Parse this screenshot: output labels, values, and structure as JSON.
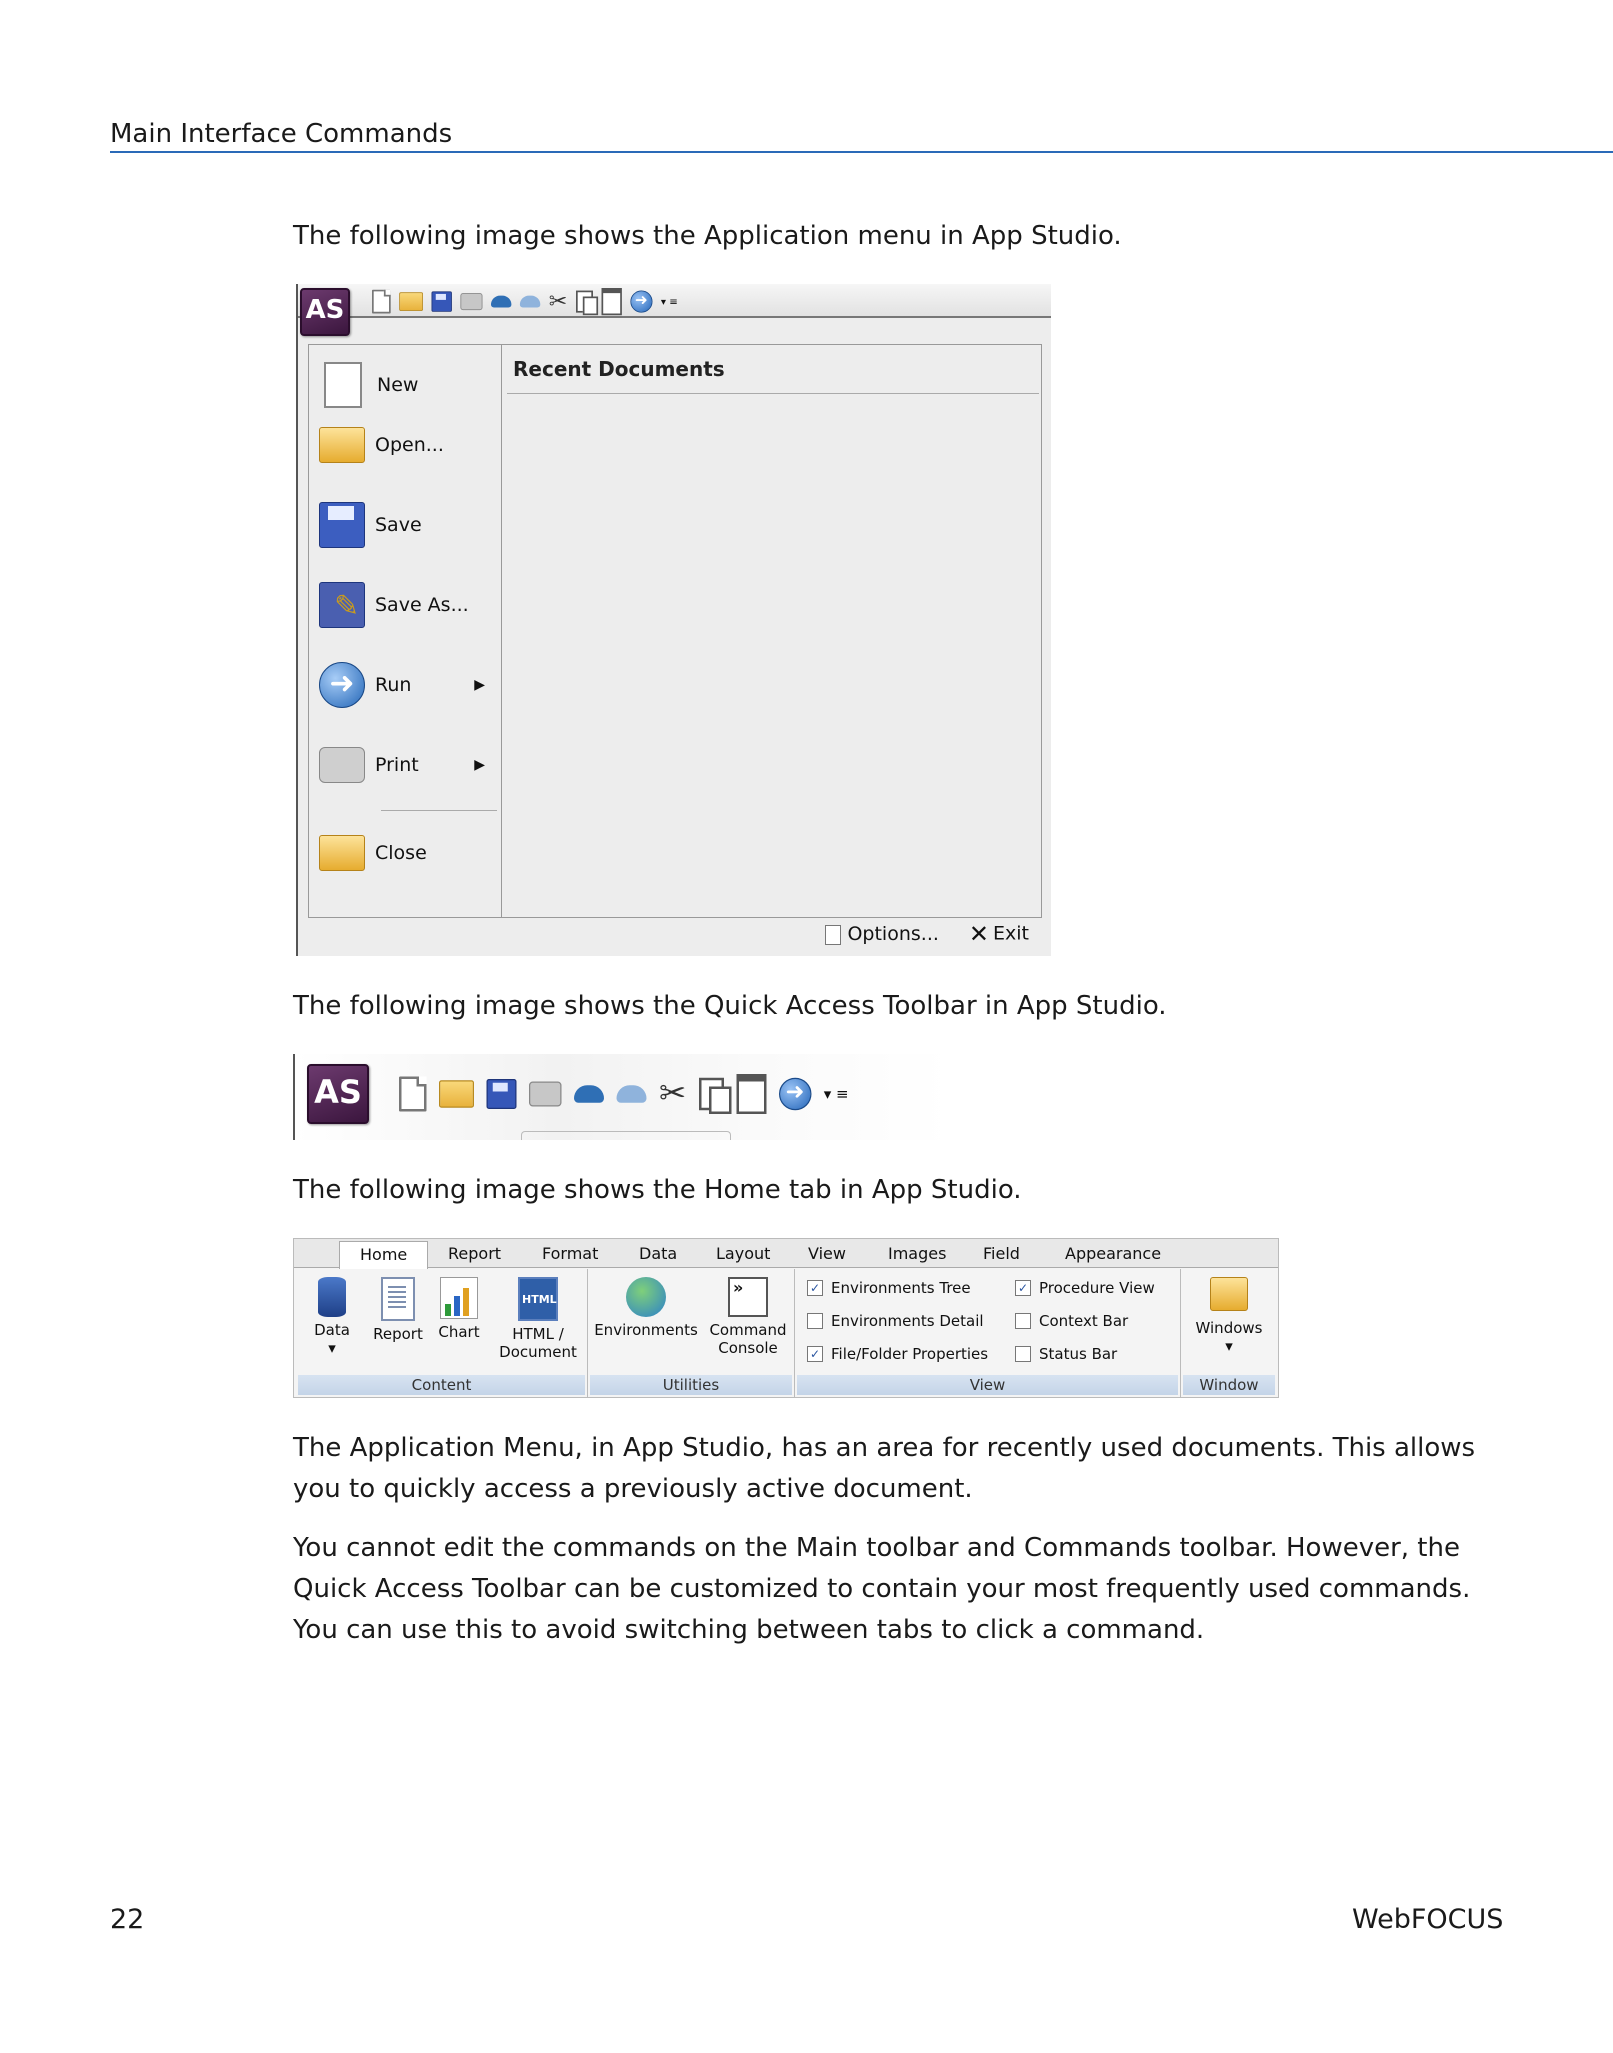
{
  "header": {
    "title": "Main Interface Commands"
  },
  "paragraphs": {
    "p1": "The following image shows the Application menu in App Studio.",
    "p2": "The following image shows the Quick Access Toolbar in App Studio.",
    "p3": "The following image shows the Home tab in App Studio.",
    "p4_line1": "The Application Menu, in App Studio, has an area for recently used documents. This allows",
    "p4_line2": "you to quickly access a previously active document.",
    "p5_line1": "You cannot edit the commands on the Main toolbar and Commands toolbar. However, the",
    "p5_line2": "Quick Access Toolbar can be customized to contain your most frequently used commands.",
    "p5_line3": "You can use this to avoid switching between tabs to click a command."
  },
  "app_logo": "AS",
  "app_menu": {
    "items": [
      {
        "label": "New"
      },
      {
        "label": "Open..."
      },
      {
        "label": "Save"
      },
      {
        "label": "Save As..."
      },
      {
        "label": "Run"
      },
      {
        "label": "Print"
      },
      {
        "label": "Close"
      }
    ],
    "submenu_arrow": "▶",
    "recent_title": "Recent Documents",
    "options_label": "Options...",
    "exit_label": "Exit"
  },
  "ribbon": {
    "tabs": [
      "Home",
      "Report",
      "Format",
      "Data",
      "Layout",
      "View",
      "Images",
      "Field",
      "Appearance"
    ],
    "content": {
      "buttons": [
        "Data",
        "Report",
        "Chart",
        "HTML /",
        "Document"
      ],
      "group": "Content"
    },
    "utilities": {
      "buttons": [
        "Environments",
        "Command",
        "Console"
      ],
      "group": "Utilities"
    },
    "view": {
      "checks": [
        {
          "label": "Environments Tree",
          "checked": true
        },
        {
          "label": "Procedure View",
          "checked": true
        },
        {
          "label": "Environments Detail",
          "checked": false
        },
        {
          "label": "Context Bar",
          "checked": false
        },
        {
          "label": "File/Folder Properties",
          "checked": true
        },
        {
          "label": "Status Bar",
          "checked": false
        }
      ],
      "group": "View"
    },
    "window": {
      "button": "Windows",
      "group": "Window"
    },
    "dropdown_arrow": "▾",
    "check_mark": "✓"
  },
  "footer": {
    "page_number": "22",
    "product": "WebFOCUS"
  }
}
